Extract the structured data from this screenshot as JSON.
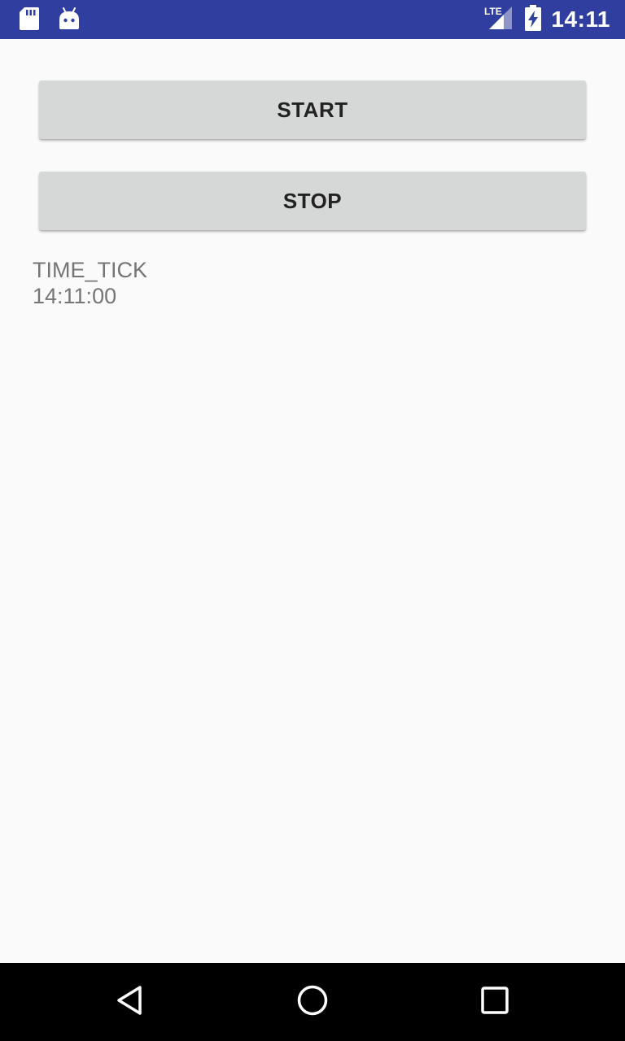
{
  "status_bar": {
    "time": "14:11",
    "network_label": "LTE",
    "icons": [
      "sd-card-icon",
      "android-icon",
      "lte-signal-icon",
      "battery-charging-icon"
    ],
    "background_color": "#303f9f"
  },
  "buttons": {
    "start_label": "START",
    "stop_label": "STOP",
    "background_color": "#d6d7d7"
  },
  "log": {
    "lines": [
      "TIME_TICK",
      "14:11:00"
    ],
    "text_color": "#757575"
  },
  "nav_bar": {
    "icons": [
      "back-icon",
      "home-icon",
      "recents-icon"
    ]
  }
}
